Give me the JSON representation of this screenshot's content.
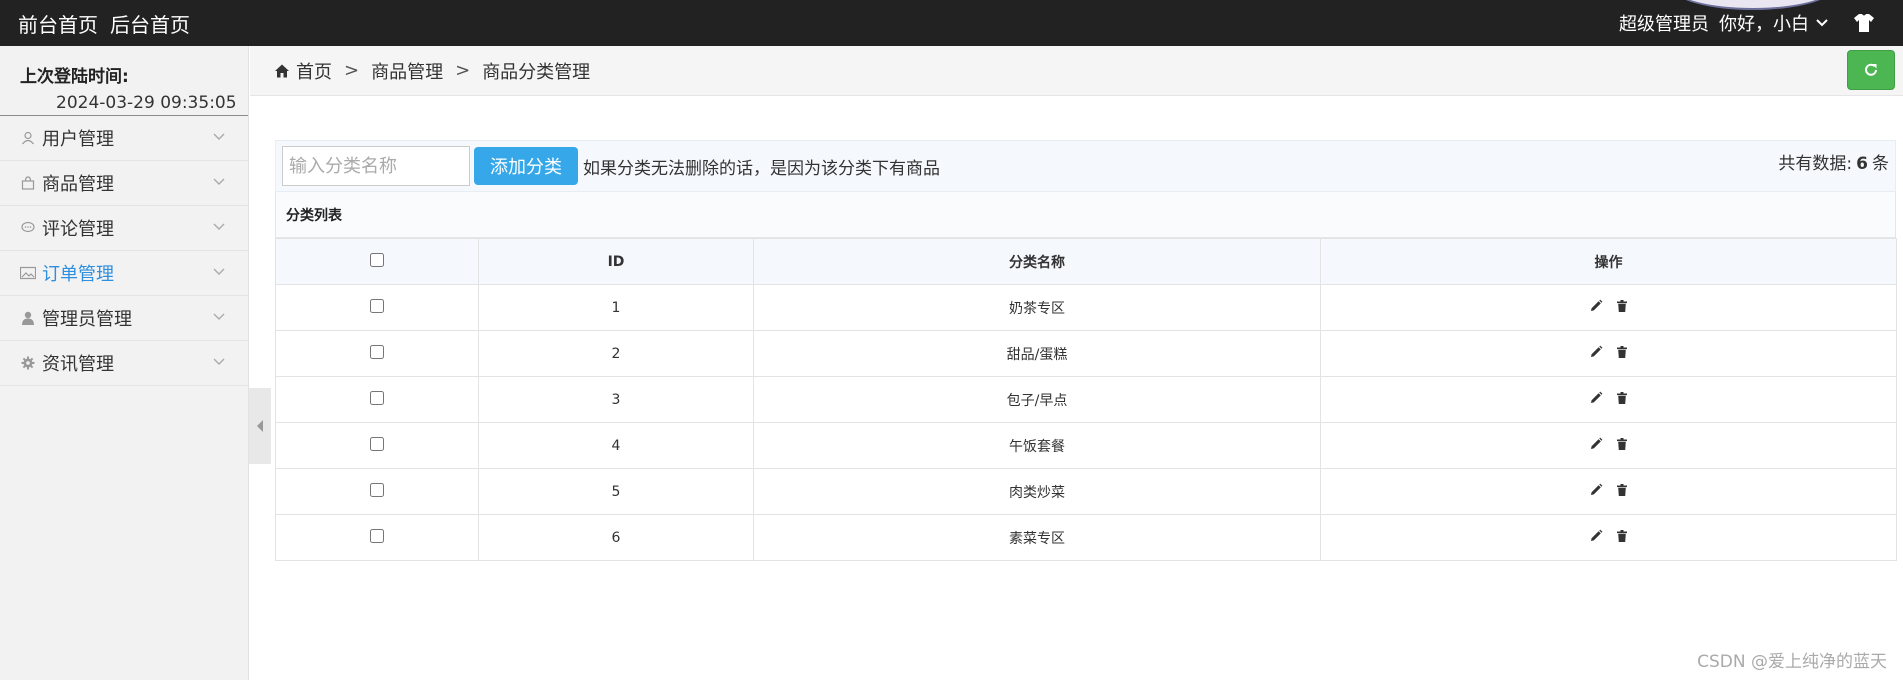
{
  "topbar": {
    "nav": [
      "前台首页",
      "后台首页"
    ],
    "role": "超级管理员",
    "greeting": "你好，小白"
  },
  "sidebar": {
    "last_login_label": "上次登陆时间:",
    "last_login_value": "2024-03-29 09:35:05",
    "items": [
      {
        "label": "用户管理",
        "icon": "user-icon"
      },
      {
        "label": "商品管理",
        "icon": "bag-icon"
      },
      {
        "label": "评论管理",
        "icon": "comment-icon"
      },
      {
        "label": "订单管理",
        "icon": "picture-icon",
        "active": true
      },
      {
        "label": "管理员管理",
        "icon": "person-icon"
      },
      {
        "label": "资讯管理",
        "icon": "gear-icon"
      }
    ]
  },
  "breadcrumb": [
    "首页",
    "商品管理",
    "商品分类管理"
  ],
  "breadcrumb_sep": ">",
  "toolbar": {
    "search_placeholder": "输入分类名称",
    "add_label": "添加分类",
    "hint": "如果分类无法删除的话，是因为该分类下有商品",
    "total_label": "共有数据:",
    "total_count": "6",
    "total_unit": "条"
  },
  "table": {
    "title": "分类列表",
    "columns": [
      "",
      "ID",
      "分类名称",
      "操作"
    ],
    "rows": [
      {
        "id": "1",
        "name": "奶茶专区"
      },
      {
        "id": "2",
        "name": "甜品/蛋糕"
      },
      {
        "id": "3",
        "name": "包子/早点"
      },
      {
        "id": "4",
        "name": "午饭套餐"
      },
      {
        "id": "5",
        "name": "肉类炒菜"
      },
      {
        "id": "6",
        "name": "素菜专区"
      }
    ]
  },
  "watermark": "CSDN @爱上纯净的蓝天",
  "colors": {
    "topbar_bg": "#222222",
    "add_button": "#36a7e8",
    "refresh_button": "#4cb653",
    "active_menu": "#2d8fe0"
  }
}
